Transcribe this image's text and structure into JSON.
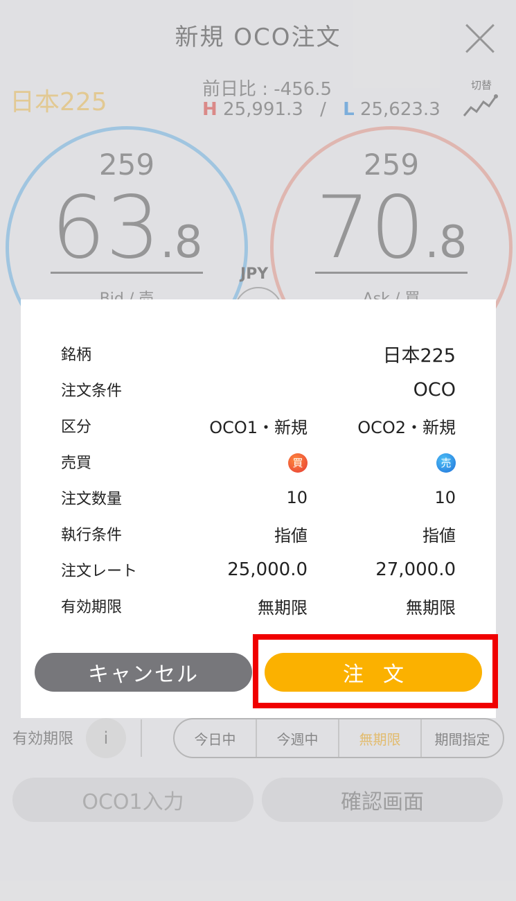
{
  "header": {
    "title": "新規 OCO注文"
  },
  "ticker": {
    "symbol": "日本225",
    "prev_change": "前日比 : -456.5",
    "high_label": "H",
    "high_value": "25,991.3",
    "separator": "/",
    "low_label": "L",
    "low_value": "25,623.3",
    "switch_label": "切替"
  },
  "bid": {
    "prefix": "259",
    "main": "63",
    "decimal": ".8",
    "label": "Bid / 売"
  },
  "ask": {
    "prefix": "259",
    "main": "70",
    "decimal": ".8",
    "label": "Ask / 買"
  },
  "currency": "JPY",
  "background_form": {
    "validity_label": "有効期限",
    "info_icon": "i",
    "validity_options": [
      "今日中",
      "今週中",
      "無期限",
      "期間指定"
    ],
    "selected_option": "無期限",
    "oco1_button": "OCO1入力",
    "confirm_button": "確認画面"
  },
  "dialog": {
    "symbol_label": "銘柄",
    "symbol_value": "日本225",
    "condition_label": "注文条件",
    "condition_value": "OCO",
    "category_label": "区分",
    "category_col1": "OCO1・新規",
    "category_col2": "OCO2・新規",
    "side_label": "売買",
    "side_col1": "買",
    "side_col2": "売",
    "qty_label": "注文数量",
    "qty_col1": "10",
    "qty_col2": "10",
    "exec_label": "執行条件",
    "exec_col1": "指値",
    "exec_col2": "指値",
    "rate_label": "注文レート",
    "rate_col1": "25,000.0",
    "rate_col2": "27,000.0",
    "expiry_label": "有効期限",
    "expiry_col1": "無期限",
    "expiry_col2": "無期限",
    "cancel_button": "キャンセル",
    "order_button": "注文"
  },
  "colors": {
    "accent_orange": "#fbb100",
    "cancel_gray": "#77777b",
    "highlight_red": "#f00000",
    "high_red": "#e53935",
    "low_blue": "#1e88e5"
  }
}
